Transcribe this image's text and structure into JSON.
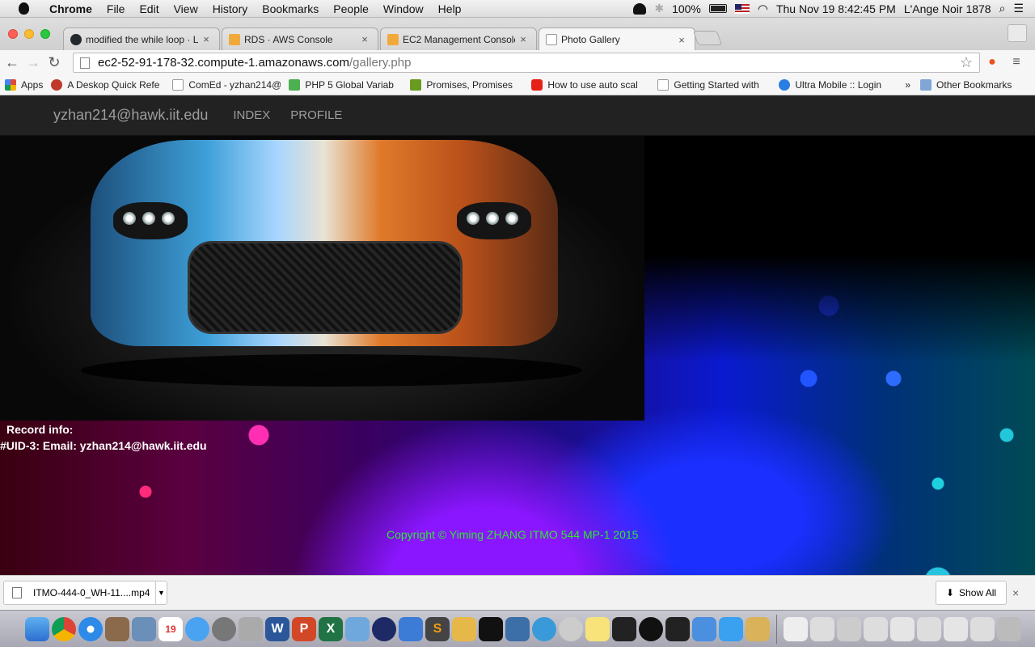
{
  "menubar": {
    "app": "Chrome",
    "items": [
      "File",
      "Edit",
      "View",
      "History",
      "Bookmarks",
      "People",
      "Window",
      "Help"
    ],
    "battery": "100%",
    "datetime": "Thu Nov 19  8:42:45 PM",
    "user": "L'Ange Noir 1878"
  },
  "tabs": [
    {
      "label": "modified the while loop · La",
      "favicon_color": "#24292e"
    },
    {
      "label": "RDS · AWS Console",
      "favicon_color": "#f2a93b"
    },
    {
      "label": "EC2 Management Console",
      "favicon_color": "#f2a93b"
    },
    {
      "label": "Photo Gallery",
      "favicon_color": "#ffffff"
    }
  ],
  "address": {
    "host": "ec2-52-91-178-32.compute-1.amazonaws.com",
    "path": "/gallery.php"
  },
  "bookmarks": [
    {
      "label": "Apps",
      "color": "#e04a3a"
    },
    {
      "label": "A Deskop Quick Refe",
      "color": "#c0392b"
    },
    {
      "label": "ComEd - yzhan214@",
      "color": "#ffffff"
    },
    {
      "label": "PHP 5 Global Variab",
      "color": "#4caf50"
    },
    {
      "label": "Promises, Promises",
      "color": "#6a9a1f"
    },
    {
      "label": "How to use auto scal",
      "color": "#e62117"
    },
    {
      "label": "Getting Started with",
      "color": "#ffffff"
    },
    {
      "label": "Ultra Mobile :: Login",
      "color": "#2a7de1"
    }
  ],
  "bookmarks_more": "»",
  "bookmarks_other": "Other Bookmarks",
  "site": {
    "brand": "yzhan214@hawk.iit.edu",
    "nav": [
      "INDEX",
      "PROFILE"
    ],
    "record_title": "Record info:",
    "record_line": "#UID-3: Email: yzhan214@hawk.iit.edu",
    "copyright": "Copyright © Yiming ZHANG ITMO 544 MP-1 2015"
  },
  "downloads": {
    "file": "ITMO-444-0_WH-11....mp4",
    "show_all": "Show All",
    "close": "×"
  },
  "colors": {
    "copyright": "#2ee82e",
    "navbar": "#222222"
  }
}
